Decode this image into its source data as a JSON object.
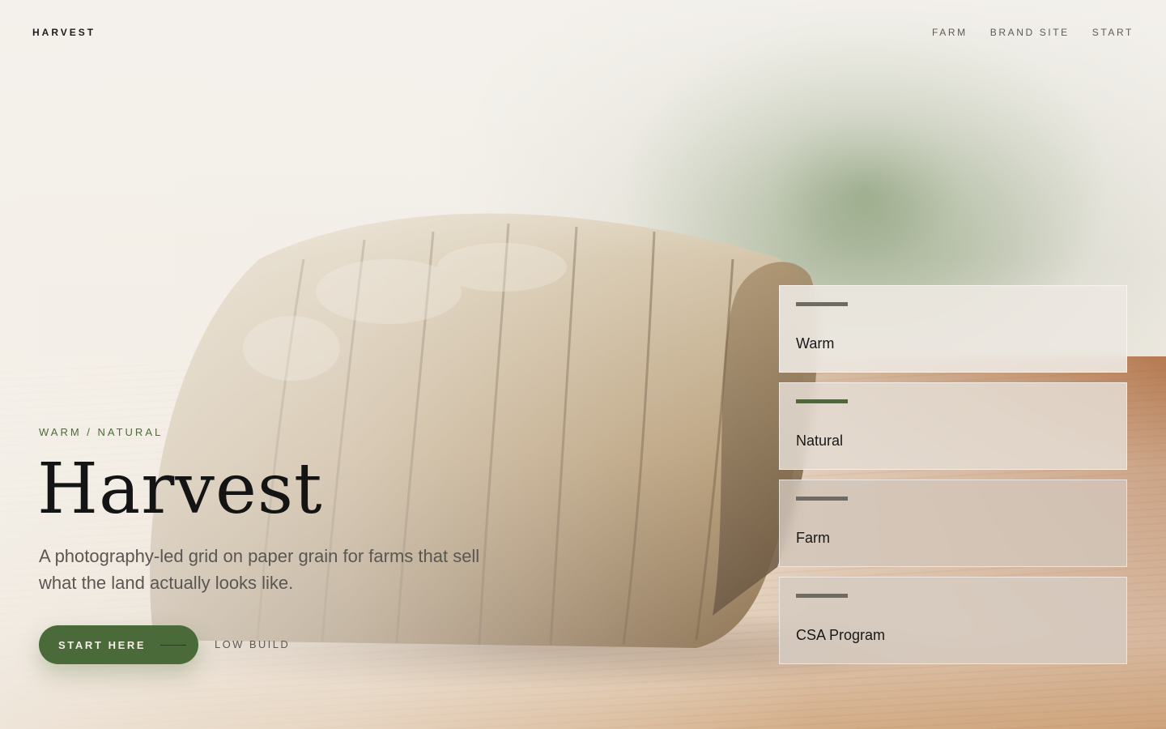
{
  "brand": {
    "name": "HARVEST"
  },
  "nav": {
    "items": [
      {
        "label": "FARM"
      },
      {
        "label": "BRAND SITE"
      },
      {
        "label": "START"
      }
    ]
  },
  "hero": {
    "eyebrow": "WARM / NATURAL",
    "title": "Harvest",
    "description": "A photography-led grid on paper grain for farms that sell what the land actually looks like.",
    "cta_label": "START HERE",
    "secondary_label": "LOW BUILD"
  },
  "cards": [
    {
      "label": "Warm",
      "active": false
    },
    {
      "label": "Natural",
      "active": true
    },
    {
      "label": "Farm",
      "active": false
    },
    {
      "label": "CSA Program",
      "active": false
    }
  ],
  "colors": {
    "accent": "#4a6b39",
    "paper": "#f3efe8",
    "text": "#141414",
    "muted": "#5a5651"
  }
}
